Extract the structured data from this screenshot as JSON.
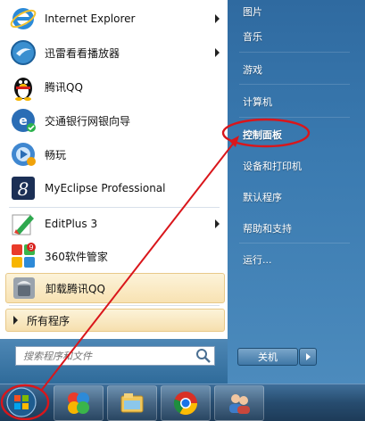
{
  "left_items": [
    {
      "label": "Internet Explorer",
      "icon": "ie-icon",
      "has_arrow": true
    },
    {
      "label": "迅雷看看播放器",
      "icon": "media-player-icon",
      "has_arrow": true
    },
    {
      "label": "腾讯QQ",
      "icon": "qq-penguin-icon",
      "has_arrow": false
    },
    {
      "label": "交通银行网银向导",
      "icon": "bank-icon",
      "has_arrow": false
    },
    {
      "label": "畅玩",
      "icon": "game-icon",
      "has_arrow": false
    },
    {
      "label": "MyEclipse Professional",
      "icon": "myeclipse-icon",
      "has_arrow": false
    },
    {
      "label": "EditPlus 3",
      "icon": "editplus-icon",
      "has_arrow": true
    },
    {
      "label": "360软件管家",
      "icon": "360-icon",
      "has_arrow": false
    },
    {
      "label": "卸载腾讯QQ",
      "icon": "uninstall-icon",
      "has_arrow": false
    }
  ],
  "all_programs": "所有程序",
  "search": {
    "placeholder": "搜索程序和文件"
  },
  "right_items": [
    {
      "label": "图片"
    },
    {
      "label": "音乐"
    },
    {
      "label": "游戏"
    },
    {
      "label": "计算机"
    },
    {
      "label": "控制面板"
    },
    {
      "label": "设备和打印机"
    },
    {
      "label": "默认程序"
    },
    {
      "label": "帮助和支持"
    },
    {
      "label": "运行..."
    }
  ],
  "shutdown": {
    "label": "关机"
  },
  "annotation_color": "#d9161b",
  "taskbar_items": [
    "start-orb-icon",
    "app-pinwheel-icon",
    "explorer-icon",
    "chrome-icon",
    "users-icon"
  ]
}
